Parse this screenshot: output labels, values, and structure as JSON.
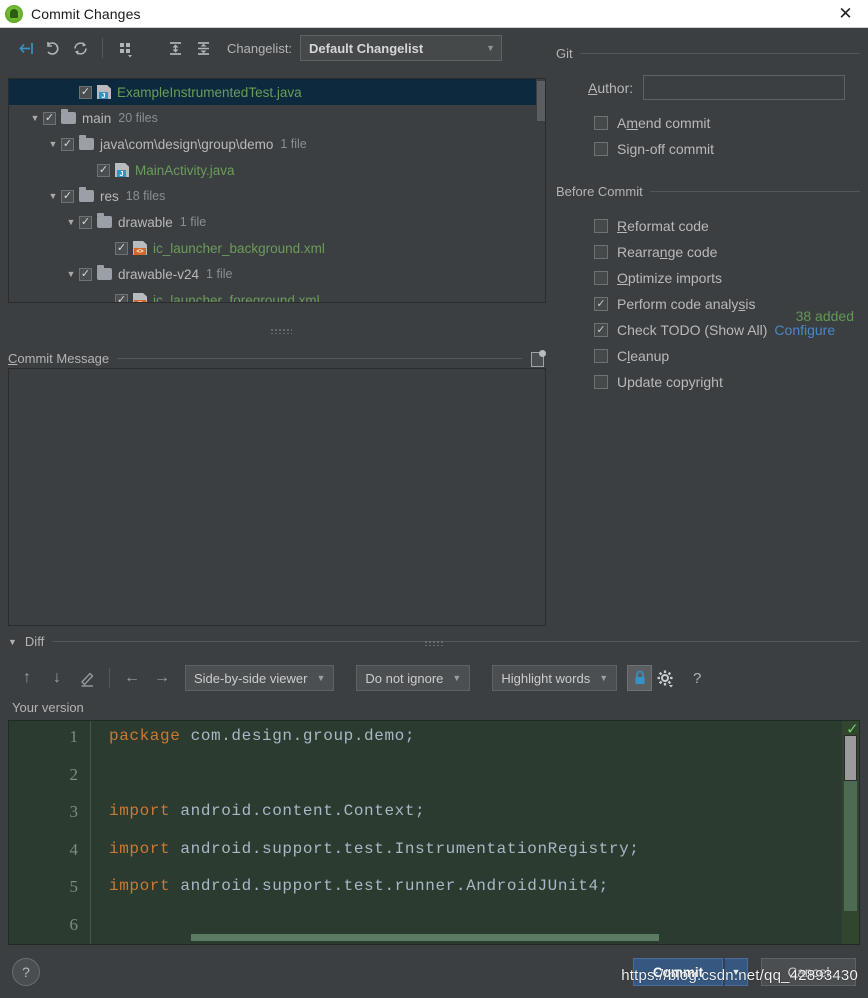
{
  "window": {
    "title": "Commit Changes",
    "app_icon": "android-studio-icon",
    "close_label": "✕"
  },
  "toolbar": {
    "icons": [
      {
        "name": "show-diff-icon",
        "glyph": "→|"
      },
      {
        "name": "revert-icon",
        "glyph": "↶"
      },
      {
        "name": "refresh-icon",
        "glyph": "↻"
      },
      {
        "name": "group-by-icon",
        "glyph": "∷"
      },
      {
        "name": "expand-all-icon",
        "glyph": "⤓"
      },
      {
        "name": "collapse-all-icon",
        "glyph": "⤒"
      }
    ],
    "changelist_label": "Changelist:",
    "changelist_value": "Default Changelist",
    "dropdown_arrow": "▼"
  },
  "tree": {
    "rows": [
      {
        "indent": 4,
        "twisty": "",
        "checked": true,
        "icon": "java-file-icon",
        "name": "ExampleInstrumentedTest.java",
        "count": "",
        "selected": true,
        "type": "file"
      },
      {
        "indent": 2,
        "twisty": "▼",
        "checked": true,
        "icon": "folder-icon",
        "name": "main",
        "count": "20 files",
        "selected": false,
        "type": "folder"
      },
      {
        "indent": 3,
        "twisty": "▼",
        "checked": true,
        "icon": "folder-icon",
        "name": "java\\com\\design\\group\\demo",
        "count": "1 file",
        "selected": false,
        "type": "folder"
      },
      {
        "indent": 5,
        "twisty": "",
        "checked": true,
        "icon": "java-file-icon",
        "name": "MainActivity.java",
        "count": "",
        "selected": false,
        "type": "file"
      },
      {
        "indent": 3,
        "twisty": "▼",
        "checked": true,
        "icon": "folder-icon",
        "name": "res",
        "count": "18 files",
        "selected": false,
        "type": "folder"
      },
      {
        "indent": 4,
        "twisty": "▼",
        "checked": true,
        "icon": "folder-icon",
        "name": "drawable",
        "count": "1 file",
        "selected": false,
        "type": "folder"
      },
      {
        "indent": 6,
        "twisty": "",
        "checked": true,
        "icon": "xml-file-icon",
        "name": "ic_launcher_background.xml",
        "count": "",
        "selected": false,
        "type": "xml"
      },
      {
        "indent": 4,
        "twisty": "▼",
        "checked": true,
        "icon": "folder-icon",
        "name": "drawable-v24",
        "count": "1 file",
        "selected": false,
        "type": "folder"
      },
      {
        "indent": 6,
        "twisty": "",
        "checked": true,
        "icon": "xml-file-icon",
        "name": "ic_launcher_foreground.xml",
        "count": "",
        "selected": false,
        "type": "xml"
      }
    ],
    "added_summary": "38 added"
  },
  "commit_message": {
    "label": "Commit Message",
    "label_mnemonic": "C",
    "value": "",
    "history_icon": "message-history-icon"
  },
  "git_panel": {
    "group_title": "Git",
    "author_label": "Author:",
    "author_mnemonic": "A",
    "author_value": "",
    "checkboxes": [
      {
        "label": "Amend commit",
        "mnemonic": "m",
        "checked": false,
        "name": "amend-commit-checkbox"
      },
      {
        "label": "Sign-off commit",
        "mnemonic": "g",
        "checked": false,
        "name": "sign-off-commit-checkbox"
      }
    ]
  },
  "before_commit": {
    "group_title": "Before Commit",
    "checkboxes": [
      {
        "label": "Reformat code",
        "mnemonic": "R",
        "checked": false,
        "name": "reformat-code-checkbox",
        "link": ""
      },
      {
        "label": "Rearrange code",
        "mnemonic": "n",
        "checked": false,
        "name": "rearrange-code-checkbox",
        "link": ""
      },
      {
        "label": "Optimize imports",
        "mnemonic": "O",
        "checked": false,
        "name": "optimize-imports-checkbox",
        "link": ""
      },
      {
        "label": "Perform code analysis",
        "mnemonic": "s",
        "checked": true,
        "name": "perform-code-analysis-checkbox",
        "link": ""
      },
      {
        "label": "Check TODO (Show All)",
        "mnemonic": "",
        "checked": true,
        "name": "check-todo-checkbox",
        "link": "Configure"
      },
      {
        "label": "Cleanup",
        "mnemonic": "l",
        "checked": false,
        "name": "cleanup-checkbox",
        "link": ""
      },
      {
        "label": "Update copyright",
        "mnemonic": "",
        "checked": false,
        "name": "update-copyright-checkbox",
        "link": ""
      }
    ]
  },
  "diff": {
    "section_title": "Diff",
    "collapse_caret": "▼",
    "tools": {
      "prev_diff": "↑",
      "next_diff": "↓",
      "edit": "✎",
      "accept_left": "←",
      "accept_right": "→",
      "viewer_mode": "Side-by-side viewer",
      "ignore_mode": "Do not ignore",
      "highlight_mode": "Highlight words",
      "lock_icon": "🔒",
      "settings_icon": "gear-icon",
      "help_icon": "?"
    },
    "your_version_label": "Your version",
    "editor": {
      "line_numbers": [
        "1",
        "2",
        "3",
        "4",
        "5",
        "6"
      ],
      "lines": [
        {
          "keyword": "package",
          "rest": " com.design.group.demo;"
        },
        {
          "keyword": "",
          "rest": ""
        },
        {
          "keyword": "import",
          "rest": " android.content.Context;"
        },
        {
          "keyword": "import",
          "rest": " android.support.test.InstrumentationRegistry;"
        },
        {
          "keyword": "import",
          "rest": " android.support.test.runner.AndroidJUnit4;"
        },
        {
          "keyword": "",
          "rest": ""
        }
      ],
      "status_check": "✓"
    }
  },
  "footer": {
    "help_label": "?",
    "commit_label": "Commit",
    "commit_dropdown": "▼",
    "cancel_label": "Cancel"
  },
  "watermark": "https://blog.csdn.net/qq_42893430",
  "colors": {
    "accent_blue": "#4a86c8",
    "selection": "#0d293e",
    "added_green": "#629755",
    "file_green": "#6a9c5a",
    "keyword_orange": "#cc7832",
    "commit_button": "#365880"
  }
}
